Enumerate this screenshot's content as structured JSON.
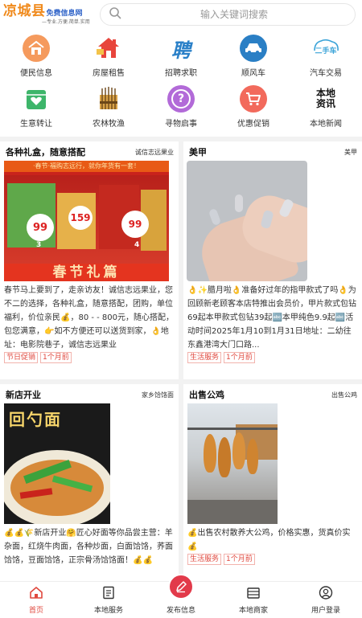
{
  "header": {
    "logo_main": "凉城县",
    "logo_sub": "免费信息网",
    "logo_slogan": "—专业.方便.简单.实用",
    "search_placeholder": "输入关键词搜索"
  },
  "categories": [
    {
      "label": "便民信息",
      "icon": "house-icon"
    },
    {
      "label": "房屋租售",
      "icon": "house-sale-icon"
    },
    {
      "label": "招聘求职",
      "icon": "recruit-icon",
      "glyph": "聘"
    },
    {
      "label": "顺风车",
      "icon": "car-icon"
    },
    {
      "label": "汽车交易",
      "icon": "used-car-icon",
      "glyph": "二手车"
    },
    {
      "label": "生意转让",
      "icon": "shop-icon"
    },
    {
      "label": "农林牧渔",
      "icon": "wheat-icon"
    },
    {
      "label": "寻物启事",
      "icon": "question-icon",
      "glyph": "?"
    },
    {
      "label": "优惠促销",
      "icon": "cart-icon"
    },
    {
      "label": "本地新闻",
      "icon": "news-icon",
      "glyph_line1": "本地",
      "glyph_line2": "资讯"
    }
  ],
  "posts": [
    {
      "title": "各种礼盒，随意搭配",
      "tag": "诚信志远果业",
      "image": {
        "banner": "·春节·福购志远行，就你年货有一套！",
        "banner2": "春节礼篇",
        "price1": "99",
        "price2": "159",
        "price3": "99",
        "n1": "3",
        "n2": "4"
      },
      "text": "春节马上要到了，走亲访友！诚信志远果业，您不二的选择，各种礼盒，随意搭配，团购，单位福利，价位亲民💰，80 - - 800元，随心搭配，包您满意，👉如不方便还可以送货到家，👌地址：电影院巷子，诚信志远果业",
      "category": "节日促销",
      "time": "1个月前"
    },
    {
      "title": "美甲",
      "tag": "美甲",
      "text": "👌✨腊月啦👌准备好过年的指甲款式了吗👌为回顾新老顾客本店特推出会员价，甲片款式包钻69起本甲款式包钻39起🔤本甲纯色9.9起🔤活动时间2025年1月10到1月31日地址：二幼往东鑫港湾大门口路...",
      "category": "生活服务",
      "time": "1个月前"
    },
    {
      "title": "新店开业",
      "tag": "家乡饸饹面",
      "image": {
        "name": "回勺面"
      },
      "text": "💰💰🌾新店开业🤗匠心好面等你品尝主营：羊杂面，红烧牛肉面，各种炒面，白面饸饹，荞面饸饹，豆面饸饹，正宗骨汤饸饹面！💰💰",
      "category": "",
      "time": ""
    },
    {
      "title": "出售公鸡",
      "tag": "出售公鸡",
      "text": "💰出售农村散养大公鸡，价格实惠，货真价实💰",
      "category": "生活服务",
      "time": "1个月前"
    }
  ],
  "bottom_nav": [
    {
      "label": "首页",
      "icon": "home-icon",
      "active": true
    },
    {
      "label": "本地服务",
      "icon": "service-icon",
      "active": false
    },
    {
      "label": "发布信息",
      "icon": "edit-icon",
      "active": false
    },
    {
      "label": "本地商家",
      "icon": "store-icon",
      "active": false
    },
    {
      "label": "用户登录",
      "icon": "user-icon",
      "active": false
    }
  ],
  "colors": {
    "accent": "#e23a4a",
    "logo_orange": "#f08a1c",
    "logo_blue": "#2f63c8",
    "tag_red": "#e0483e"
  }
}
